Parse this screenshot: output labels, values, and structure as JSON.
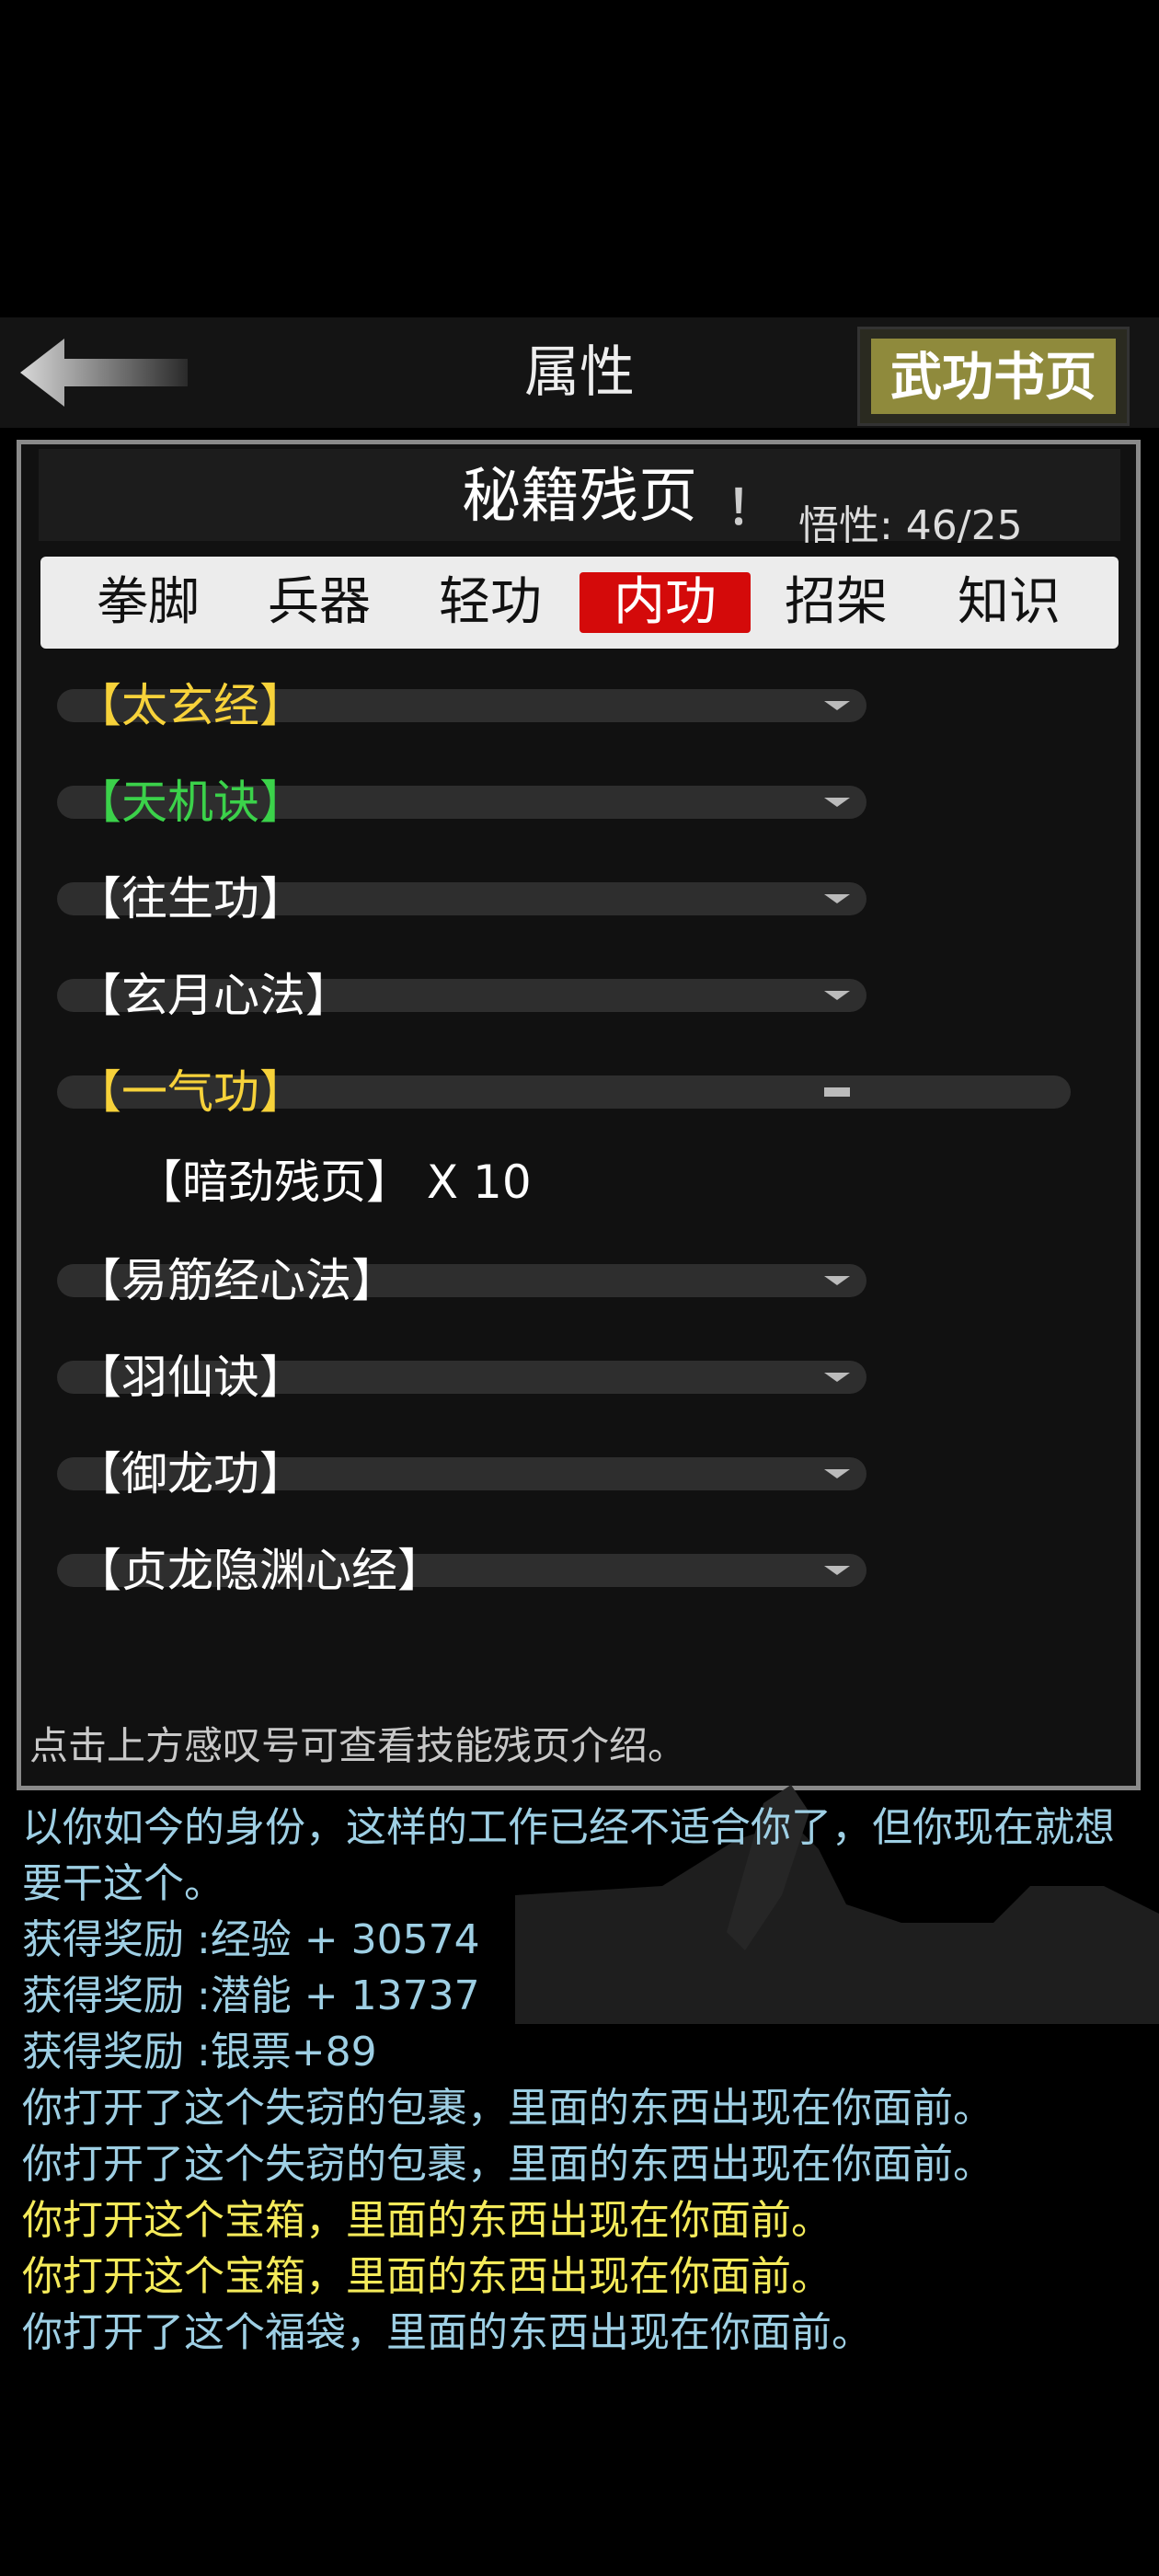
{
  "header": {
    "title": "属性",
    "pages_button": "武功书页"
  },
  "panel": {
    "sub_title": "秘籍残页",
    "exclaim": "！",
    "wuxing": "悟性: 46/25",
    "tabs": [
      "拳脚",
      "兵器",
      "轻功",
      "内功",
      "招架",
      "知识"
    ],
    "active_tab": "内功",
    "skills": [
      {
        "name": "【太玄经】",
        "color": "yellow",
        "expanded": false
      },
      {
        "name": "【天机诀】",
        "color": "green",
        "expanded": false
      },
      {
        "name": "【往生功】",
        "color": "white",
        "expanded": false
      },
      {
        "name": "【玄月心法】",
        "color": "white",
        "expanded": false
      },
      {
        "name": "【一气功】",
        "color": "yellow",
        "expanded": true
      },
      {
        "name": "【易筋经心法】",
        "color": "white",
        "expanded": false
      },
      {
        "name": "【羽仙诀】",
        "color": "white",
        "expanded": false
      },
      {
        "name": "【御龙功】",
        "color": "white",
        "expanded": false
      },
      {
        "name": "【贞龙隐渊心经】",
        "color": "white",
        "expanded": false
      }
    ],
    "sub_item": "【暗劲残页】 X 10",
    "hint": "点击上方感叹号可查看技能残页介绍。"
  },
  "log": [
    {
      "text": "以你如今的身份，这样的工作已经不适合你了，但你现在就想要干这个。",
      "color": "blue"
    },
    {
      "text": "获得奖励 :经验 + 30574",
      "color": "blue"
    },
    {
      "text": "获得奖励 :潜能 + 13737",
      "color": "blue"
    },
    {
      "text": "获得奖励 :银票+89",
      "color": "blue"
    },
    {
      "text": "你打开了这个失窃的包裹，里面的东西出现在你面前。",
      "color": "blue"
    },
    {
      "text": "你打开了这个失窃的包裹，里面的东西出现在你面前。",
      "color": "blue"
    },
    {
      "text": "你打开这个宝箱，里面的东西出现在你面前。",
      "color": "yellow"
    },
    {
      "text": "你打开这个宝箱，里面的东西出现在你面前。",
      "color": "yellow"
    },
    {
      "text": "你打开了这个福袋，里面的东西出现在你面前。",
      "color": "blue"
    }
  ],
  "colors": {
    "active_tab": "#d40a0a",
    "skill_yellow": "#f7d23a",
    "skill_green": "#3bd24a",
    "log_blue": "#9ecfe4",
    "log_yellow": "#f4ea5a"
  }
}
